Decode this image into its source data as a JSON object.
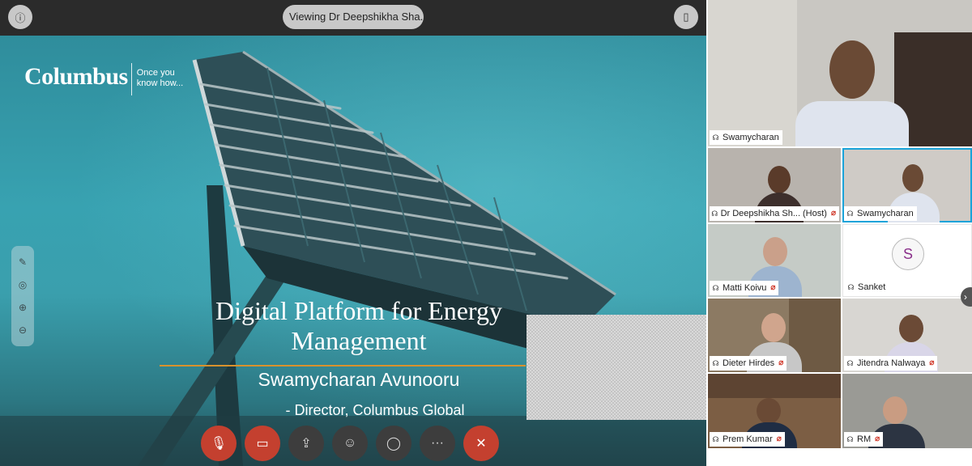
{
  "topbar": {
    "info_icon": "info-icon",
    "viewing_label": "Viewing Dr Deepshikha Sha...",
    "layout_icon": "layout-toggle-icon"
  },
  "slide": {
    "logo_word": "Columbus",
    "logo_tagline": "Once you know how...",
    "title": "Digital Platform for Energy Management",
    "presenter": "Swamycharan Avunooru",
    "role": "- Director, Columbus Global"
  },
  "annotation_toolbar": [
    "pen-icon",
    "pointer-icon",
    "zoom-in-icon",
    "zoom-out-icon"
  ],
  "controls": [
    {
      "name": "mute-mic-button",
      "icon": "mic-off-icon",
      "glyph": "⊘"
    },
    {
      "name": "stop-video-button",
      "icon": "video-off-icon",
      "glyph": "▭"
    },
    {
      "name": "share-button",
      "icon": "share-icon",
      "glyph": "⇪"
    },
    {
      "name": "participants-button",
      "icon": "participants-icon",
      "glyph": "☺"
    },
    {
      "name": "chat-button",
      "icon": "chat-icon",
      "glyph": "◯"
    },
    {
      "name": "more-button",
      "icon": "more-icon",
      "glyph": "···"
    },
    {
      "name": "leave-button",
      "icon": "close-icon",
      "glyph": "✕"
    }
  ],
  "participants": {
    "active_speaker": "Swamycharan",
    "tiles": [
      {
        "name": "Dr Deepshikha Sh...",
        "suffix": "(Host)",
        "muted": true
      },
      {
        "name": "Swamycharan",
        "suffix": "",
        "muted": false
      },
      {
        "name": "Matti Koivu",
        "suffix": "",
        "muted": true
      },
      {
        "name": "Sanket",
        "suffix": "",
        "muted": false,
        "avatar_letter": "S"
      },
      {
        "name": "Dieter Hirdes",
        "suffix": "",
        "muted": true
      },
      {
        "name": "Jitendra Nalwaya",
        "suffix": "",
        "muted": true
      },
      {
        "name": "Prem Kumar",
        "suffix": "",
        "muted": true
      },
      {
        "name": "RM",
        "suffix": "",
        "muted": true
      }
    ]
  },
  "colors": {
    "accent_blue": "#1aa3d9",
    "leave_red": "#c4402f",
    "title_rule": "#d9922d"
  }
}
